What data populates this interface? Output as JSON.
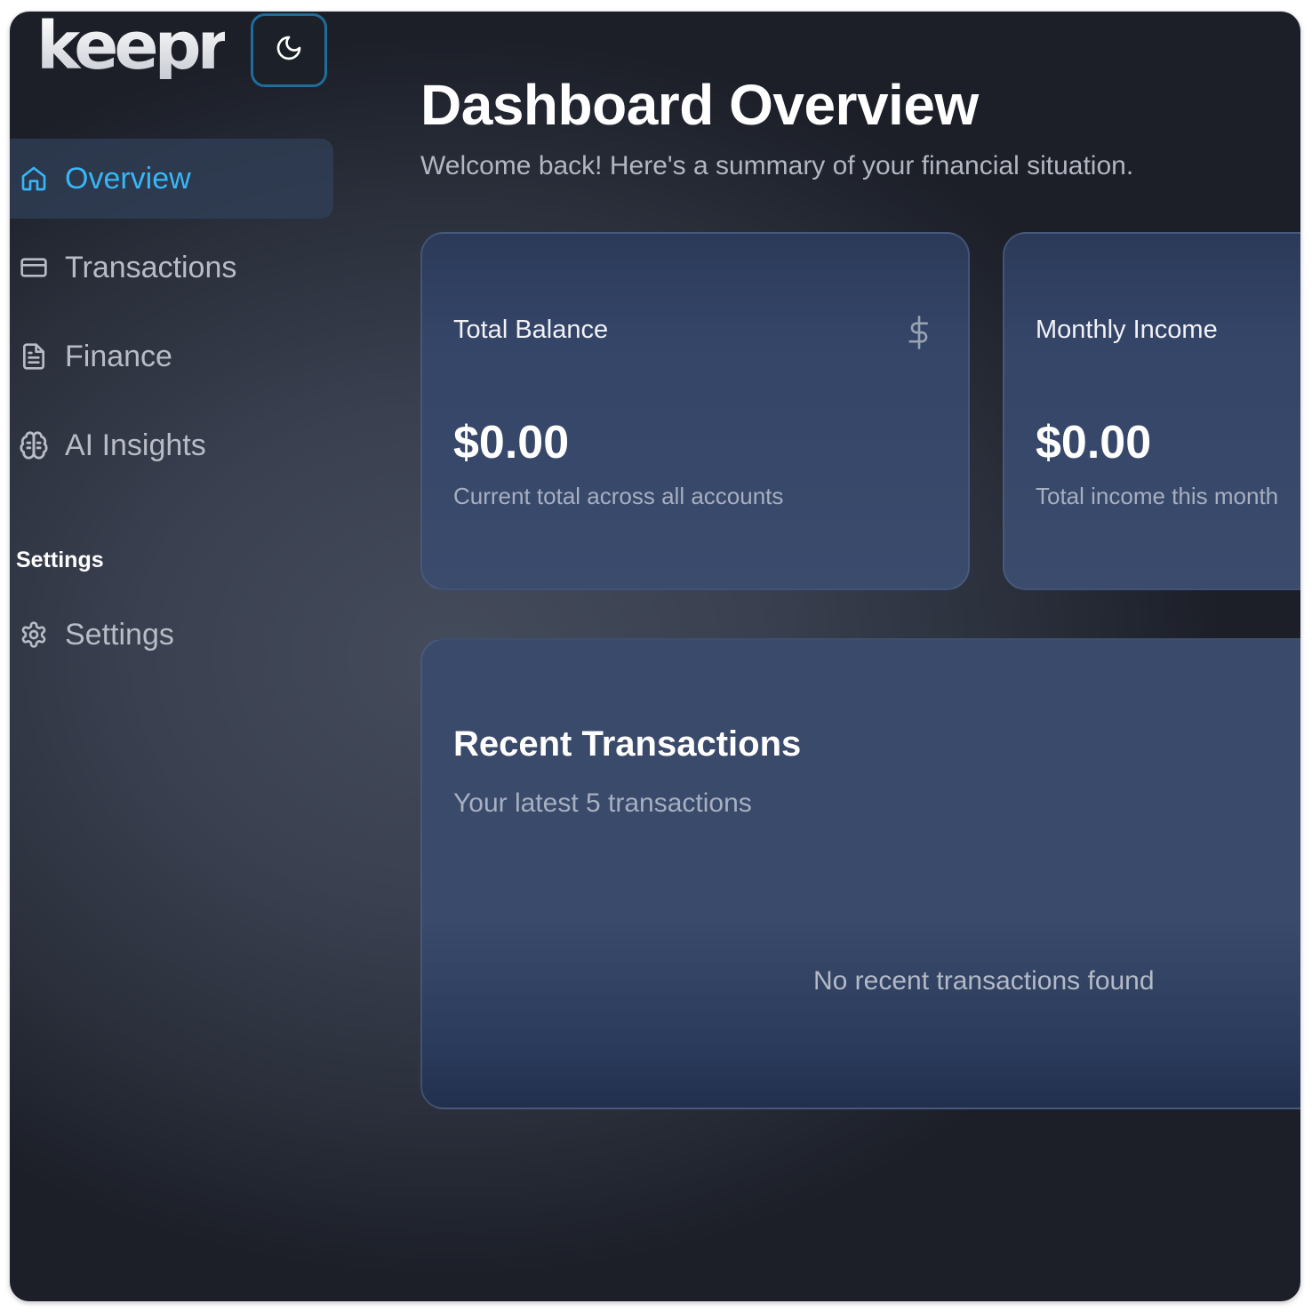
{
  "app": {
    "logo_text": "keepr"
  },
  "sidebar": {
    "items": [
      {
        "label": "Overview",
        "icon": "home-icon",
        "active": true
      },
      {
        "label": "Transactions",
        "icon": "credit-card-icon",
        "active": false
      },
      {
        "label": "Finance",
        "icon": "file-text-icon",
        "active": false
      },
      {
        "label": "AI Insights",
        "icon": "brain-icon",
        "active": false
      }
    ],
    "settings_section_label": "Settings",
    "settings_item": {
      "label": "Settings",
      "icon": "gear-icon"
    }
  },
  "main": {
    "title": "Dashboard Overview",
    "subtitle": "Welcome back! Here's a summary of your financial situation.",
    "stat_cards": [
      {
        "label": "Total Balance",
        "value": "$0.00",
        "description": "Current total across all accounts",
        "icon": "dollar-icon"
      },
      {
        "label": "Monthly Income",
        "value": "$0.00",
        "description": "Total income this month"
      }
    ],
    "recent": {
      "title": "Recent Transactions",
      "subtitle": "Your latest 5 transactions",
      "empty_text": "No recent transactions found"
    }
  },
  "colors": {
    "accent": "#38b6f5",
    "toggle_border": "#1e6d9a",
    "card_bg": "#3a4b6c"
  }
}
